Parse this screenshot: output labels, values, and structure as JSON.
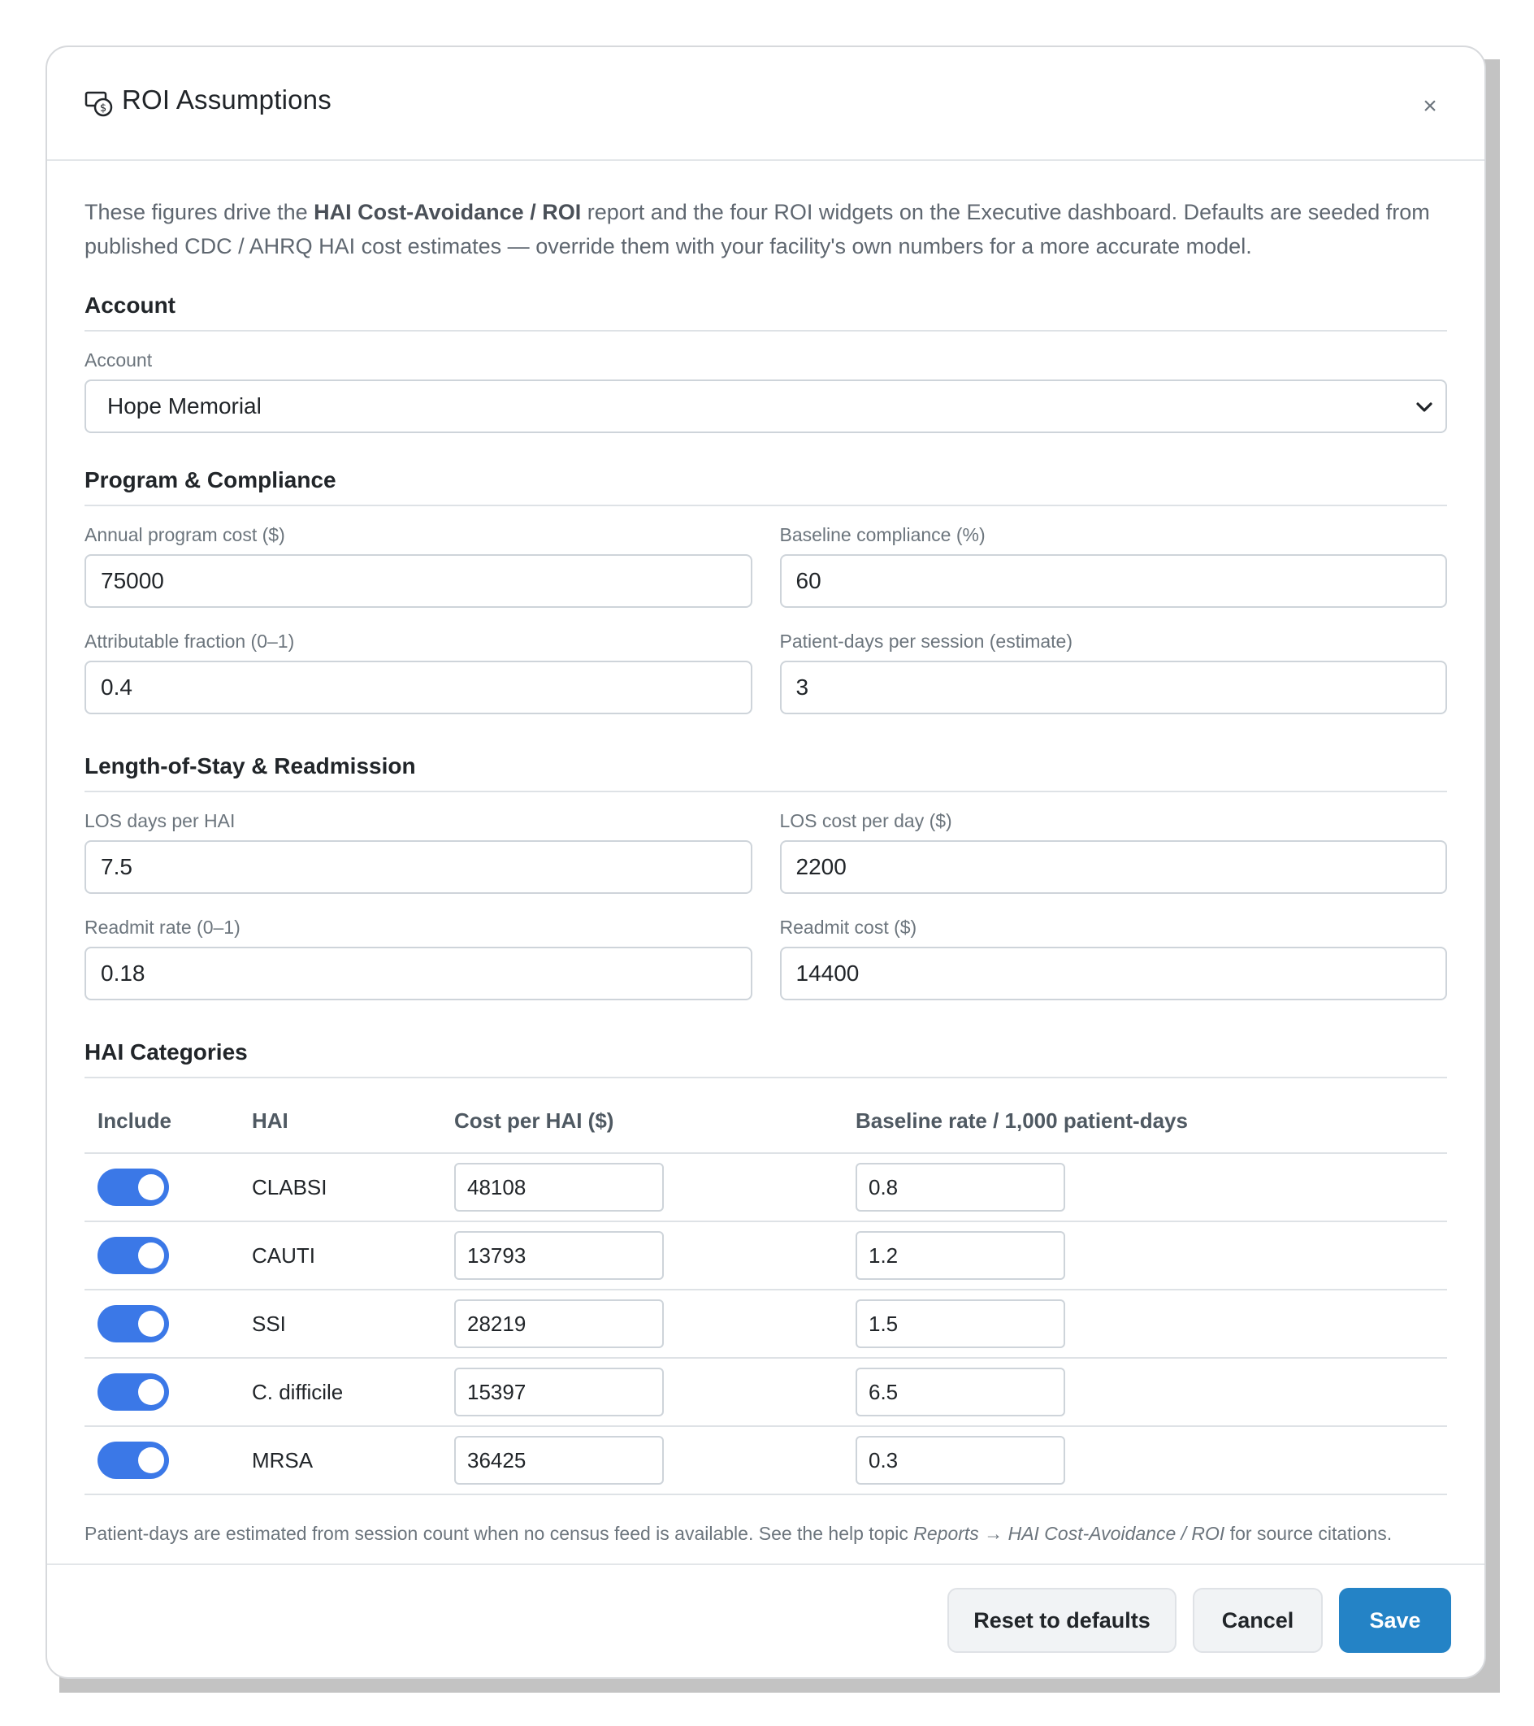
{
  "modal": {
    "title": "ROI Assumptions",
    "title_icon": "cash-coin-icon",
    "close_label": "×"
  },
  "intro": {
    "part1": "These figures drive the ",
    "bold": "HAI Cost-Avoidance / ROI",
    "part2": " report and the four ROI widgets on the Executive dashboard. Defaults are seeded from published CDC / AHRQ HAI cost estimates — override them with your facility's own numbers for a more accurate model."
  },
  "account_section": {
    "title": "Account",
    "label": "Account",
    "selected": "Hope Memorial"
  },
  "program_section": {
    "title": "Program & Compliance",
    "annual_cost_label": "Annual program cost ($)",
    "annual_cost_value": "75000",
    "baseline_compliance_label": "Baseline compliance (%)",
    "baseline_compliance_value": "60",
    "attributable_fraction_label": "Attributable fraction (0–1)",
    "attributable_fraction_value": "0.4",
    "patient_days_label": "Patient-days per session (estimate)",
    "patient_days_value": "3"
  },
  "los_section": {
    "title": "Length-of-Stay & Readmission",
    "los_days_label": "LOS days per HAI",
    "los_days_value": "7.5",
    "los_cost_label": "LOS cost per day ($)",
    "los_cost_value": "2200",
    "readmit_rate_label": "Readmit rate (0–1)",
    "readmit_rate_value": "0.18",
    "readmit_cost_label": "Readmit cost ($)",
    "readmit_cost_value": "14400"
  },
  "hai_section": {
    "title": "HAI Categories",
    "headers": {
      "include": "Include",
      "hai": "HAI",
      "cost": "Cost per HAI ($)",
      "rate": "Baseline rate / 1,000 patient-days"
    },
    "rows": [
      {
        "name": "CLABSI",
        "include": true,
        "cost": "48108",
        "rate": "0.8"
      },
      {
        "name": "CAUTI",
        "include": true,
        "cost": "13793",
        "rate": "1.2"
      },
      {
        "name": "SSI",
        "include": true,
        "cost": "28219",
        "rate": "1.5"
      },
      {
        "name": "C. difficile",
        "include": true,
        "cost": "15397",
        "rate": "6.5"
      },
      {
        "name": "MRSA",
        "include": true,
        "cost": "36425",
        "rate": "0.3"
      }
    ],
    "toggle_color": "#3b78e7"
  },
  "footnote": {
    "part1": "Patient-days are estimated from session count when no census feed is available. See the help topic ",
    "italic": "Reports → HAI Cost-Avoidance / ROI",
    "part2": " for source citations."
  },
  "footer": {
    "reset_label": "Reset to defaults",
    "cancel_label": "Cancel",
    "save_label": "Save",
    "primary_color": "#2483c6"
  }
}
